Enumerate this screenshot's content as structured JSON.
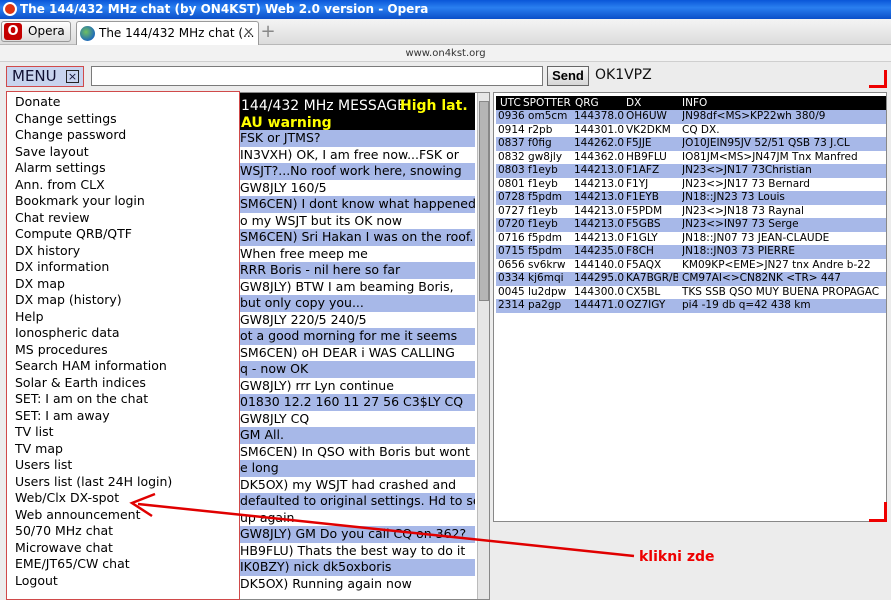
{
  "window": {
    "title": "The 144/432 MHz chat (by ON4KST) Web 2.0 version - Opera"
  },
  "browser": {
    "opera_label": "Opera",
    "tab_label": "The 144/432 MHz chat (...",
    "tab_close": "×",
    "new_tab": "+",
    "url": "www.on4kst.org"
  },
  "toolbar": {
    "menu_label": "MENU",
    "menu_close": "×",
    "message_value": "",
    "send_label": "Send",
    "callsign": "OK1VPZ"
  },
  "menu": {
    "items": [
      "Donate",
      "Change settings",
      "Change password",
      "Save layout",
      "Alarm settings",
      "Ann. from CLX",
      "Bookmark your login",
      "Chat review",
      "Compute QRB/QTF",
      "DX history",
      "DX information",
      "DX map",
      "DX map (history)",
      "Help",
      "Ionospheric data",
      "MS procedures",
      "Search HAM information",
      "Solar & Earth indices",
      "SET: I am on the chat",
      "SET: I am away",
      "TV list",
      "TV map",
      "Users list",
      "Users list (last 24H login)",
      "Web/Clx DX-spot",
      "Web announcement",
      "50/70 MHz chat",
      "Microwave chat",
      "EME/JT65/CW chat",
      "Logout"
    ]
  },
  "chat": {
    "title": "144/432 MHz MESSAGE",
    "highlight": "High lat.",
    "warning": "AU warning",
    "lines": [
      "FSK or JTMS?",
      "IN3VXH) OK, I am free now...FSK or",
      "WSJT?...No roof work here, snowing",
      "GW8JLY 160/5",
      "SM6CEN) I dont know what happened",
      "o my WSJT but its OK now",
      "SM6CEN) Sri Hakan I was on the roof.",
      "When free meep me",
      "RRR Boris - nil here so far",
      "GW8JLY) BTW I am beaming Boris,",
      "but only copy you...",
      "GW8JLY 220/5 240/5",
      "ot a good morning for me it seems",
      "SM6CEN) oH DEAR i WAS CALLING",
      "q - now OK",
      "GW8JLY) rrr Lyn continue",
      "01830 12.2 160 11 27 56 C3$LY CQ",
      "GW8JLY CQ",
      "GM All.",
      "SM6CEN) In QSO with Boris but wont",
      "e long",
      "DK5OX) my WSJT had crashed and",
      "defaulted to original settings. Hd to set",
      "up again",
      "GW8JLY) GM Do you call CQ on 362?",
      "HB9FLU) Thats the best way to do it",
      "IK0BZY) nick dk5oxboris",
      "DK5OX) Running again now"
    ]
  },
  "cluster": {
    "headers": [
      "UTC",
      "SPOTTER",
      "QRG",
      "DX",
      "INFO"
    ],
    "header_text": "UTC SPOTTER QRG      DX         INFO",
    "rows": [
      [
        "0936 om5cm",
        "144378.0",
        "OH6UW",
        "JN98df<MS>KP22wh 380/9"
      ],
      [
        "0914 r2pb",
        "144301.0",
        "VK2DKM",
        "CQ DX."
      ],
      [
        "0837 f0fig",
        "144262.0",
        "F5JJE",
        "JO10JEIN95JV 52/51 QSB 73 J.CL"
      ],
      [
        "0832 gw8jly",
        "144362.0",
        "HB9FLU",
        "IO81JM<MS>JN47JM Tnx Manfred"
      ],
      [
        "0803 f1eyb",
        "144213.0",
        "F1AFZ",
        "JN23<>JN17 73Christian"
      ],
      [
        "0801 f1eyb",
        "144213.0",
        "F1YJ",
        "JN23<>JN17 73 Bernard"
      ],
      [
        "0728 f5pdm",
        "144213.0",
        "F1EYB",
        "JN18::JN23 73 Louis"
      ],
      [
        "0727 f1eyb",
        "144213.0",
        "F5PDM",
        "JN23<>JN18 73 Raynal"
      ],
      [
        "0720 f1eyb",
        "144213.0",
        "F5GBS",
        "JN23<>IN97 73 Serge"
      ],
      [
        "0716 f5pdm",
        "144213.0",
        "F1GLY",
        "JN18::JN07 73 JEAN-CLAUDE"
      ],
      [
        "0715 f5pdm",
        "144235.0",
        "F8CH",
        "JN18::JN03 73 PIERRE"
      ],
      [
        "0656 sv6krw",
        "144140.0",
        "F5AQX",
        "KM09KP<EME>JN27 tnx Andre b-22"
      ],
      [
        "0334 kj6mqi",
        "144295.0",
        "KA7BGR/B",
        "CM97AI<>CN82NK <TR> 447"
      ],
      [
        "0045 lu2dpw",
        "144300.0",
        "CX5BL",
        "TKS SSB QSO MUY BUENA PROPAGAC"
      ],
      [
        "2314 pa2gp",
        "144471.0",
        "OZ7IGY",
        "pi4 -19 db q=42 438 km"
      ]
    ]
  },
  "annotation": {
    "text": "klikni zde"
  },
  "colors": {
    "accent_red": "#e00000",
    "row_blue": "#a7b8e8"
  }
}
